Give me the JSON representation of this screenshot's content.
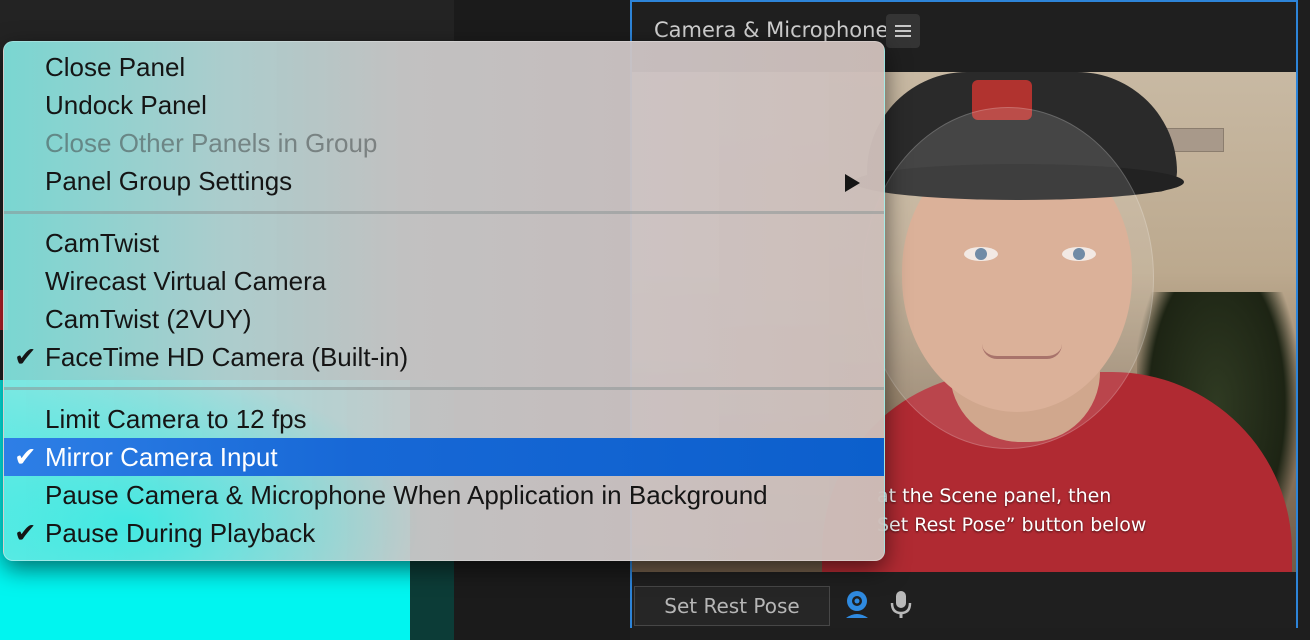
{
  "panel": {
    "title": "Camera & Microphone",
    "hint_line1": "at the Scene panel, then",
    "hint_line2": "Set Rest Pose” button below",
    "rest_button": "Set Rest Pose"
  },
  "menu": {
    "items": [
      {
        "label": "Close Panel",
        "checked": false,
        "disabled": false
      },
      {
        "label": "Undock Panel",
        "checked": false,
        "disabled": false
      },
      {
        "label": "Close Other Panels in Group",
        "checked": false,
        "disabled": true
      },
      {
        "label": "Panel Group Settings",
        "checked": false,
        "disabled": false,
        "submenu": true
      },
      {
        "label": "CamTwist",
        "checked": false,
        "disabled": false
      },
      {
        "label": "Wirecast Virtual Camera",
        "checked": false,
        "disabled": false
      },
      {
        "label": "CamTwist (2VUY)",
        "checked": false,
        "disabled": false
      },
      {
        "label": "FaceTime HD Camera (Built-in)",
        "checked": true,
        "disabled": false
      },
      {
        "label": "Limit Camera to 12 fps",
        "checked": false,
        "disabled": false
      },
      {
        "label": "Mirror Camera Input",
        "checked": true,
        "disabled": false,
        "highlighted": true
      },
      {
        "label": "Pause Camera & Microphone When Application in Background",
        "checked": false,
        "disabled": false
      },
      {
        "label": "Pause During Playback",
        "checked": true,
        "disabled": false
      }
    ],
    "checkmark": "✔"
  },
  "colors": {
    "highlight": "#1768d6",
    "panel_border": "#2d84d8",
    "webcam_icon": "#2f8ae0"
  },
  "icons": [
    "hamburger-icon",
    "submenu-arrow-icon",
    "checkmark-icon",
    "webcam-icon",
    "microphone-icon"
  ]
}
